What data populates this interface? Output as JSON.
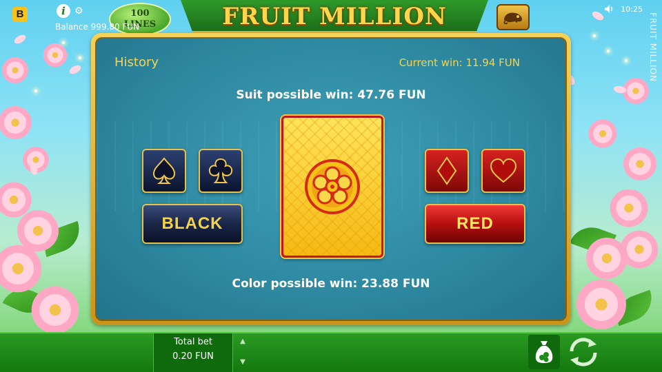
{
  "brand": {
    "letter": "B"
  },
  "header": {
    "lines_number": "100",
    "lines_word": "LINES",
    "game_logo": "FRUIT MILLION",
    "side_title": "FRUIT MILLION",
    "time": "10:25"
  },
  "panel": {
    "history_label": "History",
    "current_win": "Current win: 11.94 FUN",
    "suit_possible_win": "Suit possible win: 47.76 FUN",
    "color_possible_win": "Color possible win: 23.88 FUN",
    "buttons": {
      "black": "BLACK",
      "red": "RED"
    },
    "suits": [
      {
        "name": "spade",
        "color": "black"
      },
      {
        "name": "club",
        "color": "black"
      },
      {
        "name": "diamond",
        "color": "red"
      },
      {
        "name": "heart",
        "color": "red"
      }
    ]
  },
  "footer": {
    "balance": "Balance 999.80 FUN",
    "total_bet_label": "Total bet",
    "total_bet_value": "0.20 FUN"
  },
  "colors": {
    "accent_gold": "#f6d453",
    "panel_teal": "#2e8aa2",
    "red": "#c0191b",
    "navy": "#1a2547",
    "bar_green": "#1f8a19"
  },
  "icons": [
    "info-icon",
    "gear-icon",
    "volume-icon",
    "chameleon-icon",
    "money-bag-icon",
    "spin-icon",
    "arrow-up-icon",
    "arrow-down-icon"
  ]
}
